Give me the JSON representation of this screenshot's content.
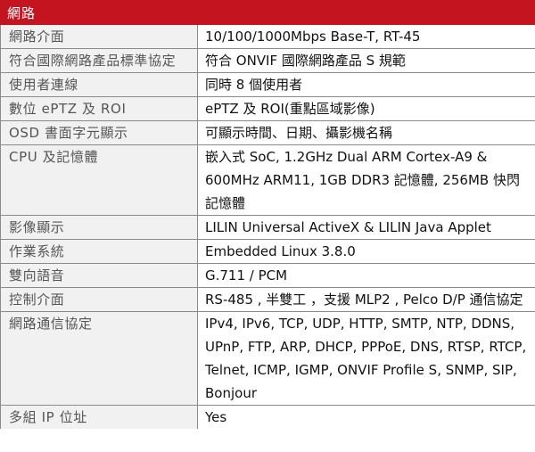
{
  "section": {
    "title": "網路"
  },
  "rows": [
    {
      "label": "網路介面",
      "value": "10/100/1000Mbps Base-T, RT-45"
    },
    {
      "label": "符合國際網路產品標準協定",
      "value": "符合 ONVIF 國際網路產品 S 規範"
    },
    {
      "label": "使用者連線",
      "value": "同時 8  個使用者"
    },
    {
      "label": "數位 ePTZ  及 ROI",
      "value": "ePTZ 及 ROI(重點區域影像)"
    },
    {
      "label": "OSD 書面字元顯示",
      "value": "可顯示時間、日期、攝影機名稱"
    },
    {
      "label": "CPU 及記憶體",
      "value": "嵌入式 SoC, 1.2GHz Dual ARM Cortex-A9 & 600MHz ARM11, 1GB DDR3 記憶體, 256MB 快閃記憶體"
    },
    {
      "label": "影像顯示",
      "value": "LILIN Universal ActiveX & LILIN Java Applet"
    },
    {
      "label": "作業系統",
      "value": "Embedded Linux 3.8.0"
    },
    {
      "label": "雙向語音",
      "value": "G.711 / PCM"
    },
    {
      "label": "控制介面",
      "value": "RS-485 ,  半雙工 ，支援 MLP2 , Pelco D/P  通信協定"
    },
    {
      "label": "網路通信協定",
      "value": "IPv4, IPv6, TCP, UDP, HTTP, SMTP, NTP, DDNS, UPnP, FTP, ARP, DHCP, PPPoE, DNS, RTSP, RTCP, Telnet, ICMP, IGMP, ONVIF Profile S, SNMP, SIP, Bonjour"
    },
    {
      "label": "多組  IP  位址",
      "value": "Yes"
    }
  ]
}
